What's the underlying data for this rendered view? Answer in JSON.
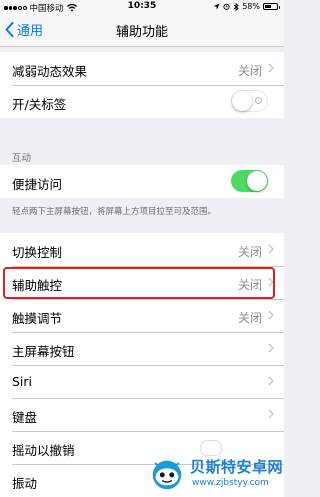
{
  "status_bar": {
    "carrier": "中国移动",
    "time": "10:35",
    "battery_percent": "58%",
    "battery_level": 0.58
  },
  "nav": {
    "back_label": "通用",
    "title": "辅助功能"
  },
  "group1": [
    {
      "label": "减弱动态效果",
      "value": "关闭",
      "type": "disclosure"
    },
    {
      "label": "开/关标签",
      "type": "switch",
      "on": false
    }
  ],
  "section_interaction": {
    "header": "互动",
    "rows": [
      {
        "label": "便捷访问",
        "type": "switch",
        "on": true
      }
    ],
    "footer": "轻点两下主屏幕按钮，将屏幕上方项目拉至可及范围。"
  },
  "group2": [
    {
      "label": "切换控制",
      "value": "关闭"
    },
    {
      "label": "辅助触控",
      "value": "关闭"
    },
    {
      "label": "触摸调节",
      "value": "关闭"
    },
    {
      "label": "主屏幕按钮",
      "value": ""
    },
    {
      "label": "Siri",
      "value": ""
    },
    {
      "label": "键盘",
      "value": ""
    },
    {
      "label": "摇动以撤销",
      "value": ""
    },
    {
      "label": "振动",
      "value": ""
    }
  ],
  "watermark": {
    "title": "贝斯特安卓网",
    "url": "www.zjbstyy.com"
  },
  "colors": {
    "accent": "#007aff",
    "switch_on": "#4cd964",
    "highlight": "#e02020",
    "background": "#efeff4"
  }
}
